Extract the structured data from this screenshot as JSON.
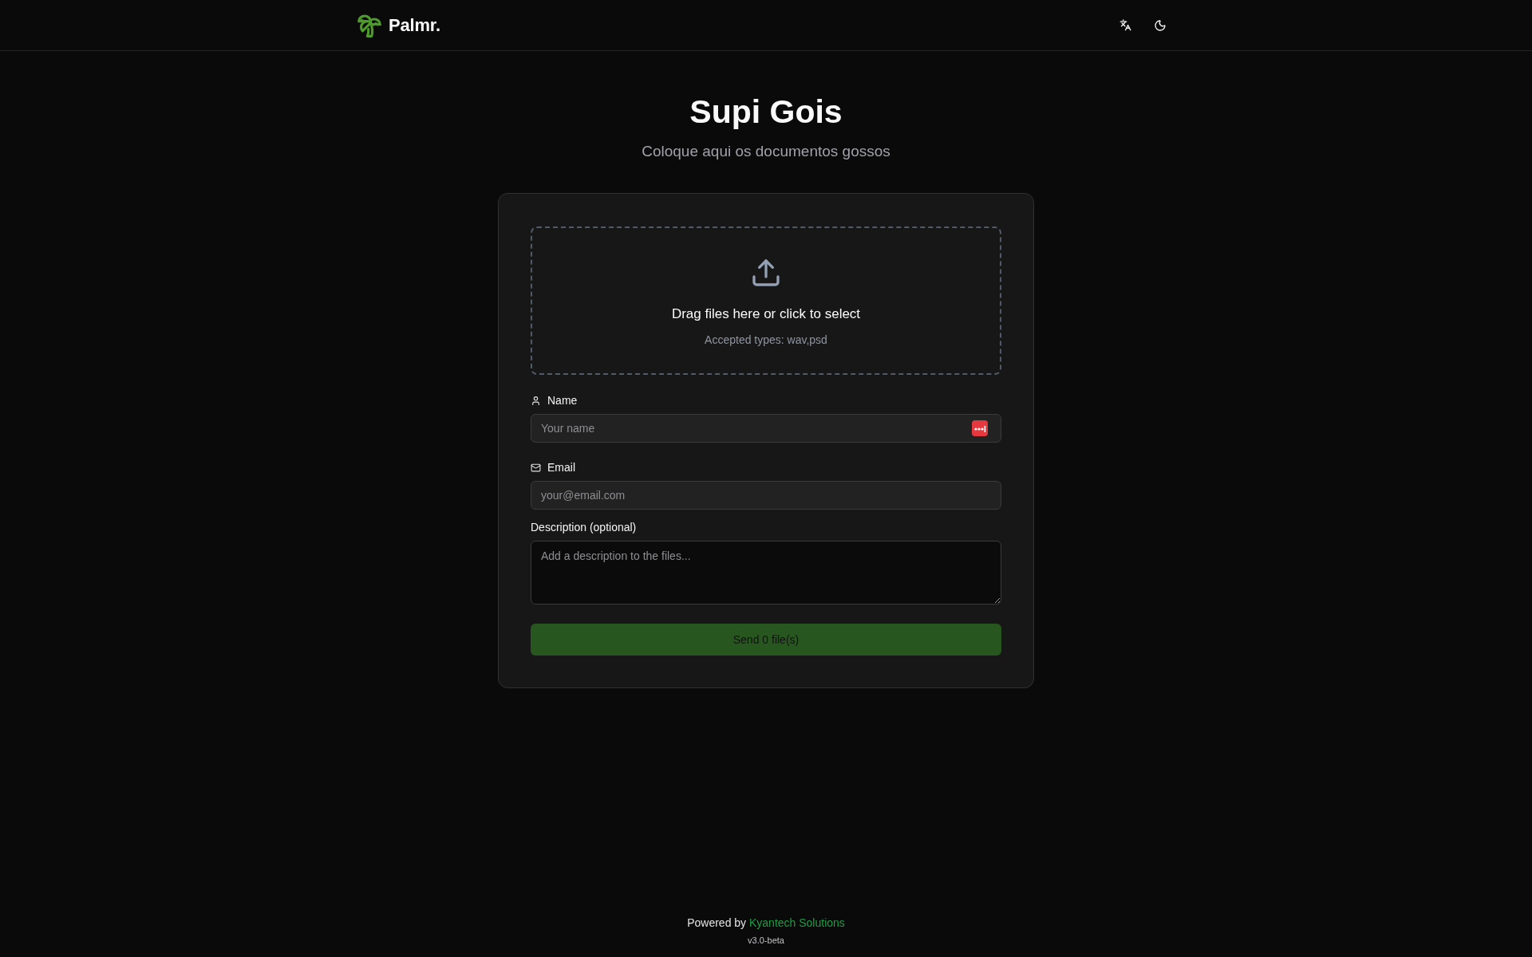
{
  "header": {
    "brand": "Palmr."
  },
  "title": "Supi Gois",
  "subtitle": "Coloque aqui os documentos gossos",
  "dropzone": {
    "prompt": "Drag files here or click to select",
    "accepted": "Accepted types: wav,psd"
  },
  "fields": [
    {
      "kind": "name",
      "label": "Name",
      "placeholder": "Your name"
    },
    {
      "kind": "email",
      "label": "Email",
      "placeholder": "your@email.com"
    },
    {
      "kind": "description",
      "label": "Description (optional)",
      "placeholder": "Add a description to the files..."
    }
  ],
  "submit": {
    "label": "Send 0 file(s)",
    "disabled": true
  },
  "footer": {
    "text": "Powered by",
    "link": "Kyantech Solutions",
    "version": "v3.0-beta"
  }
}
